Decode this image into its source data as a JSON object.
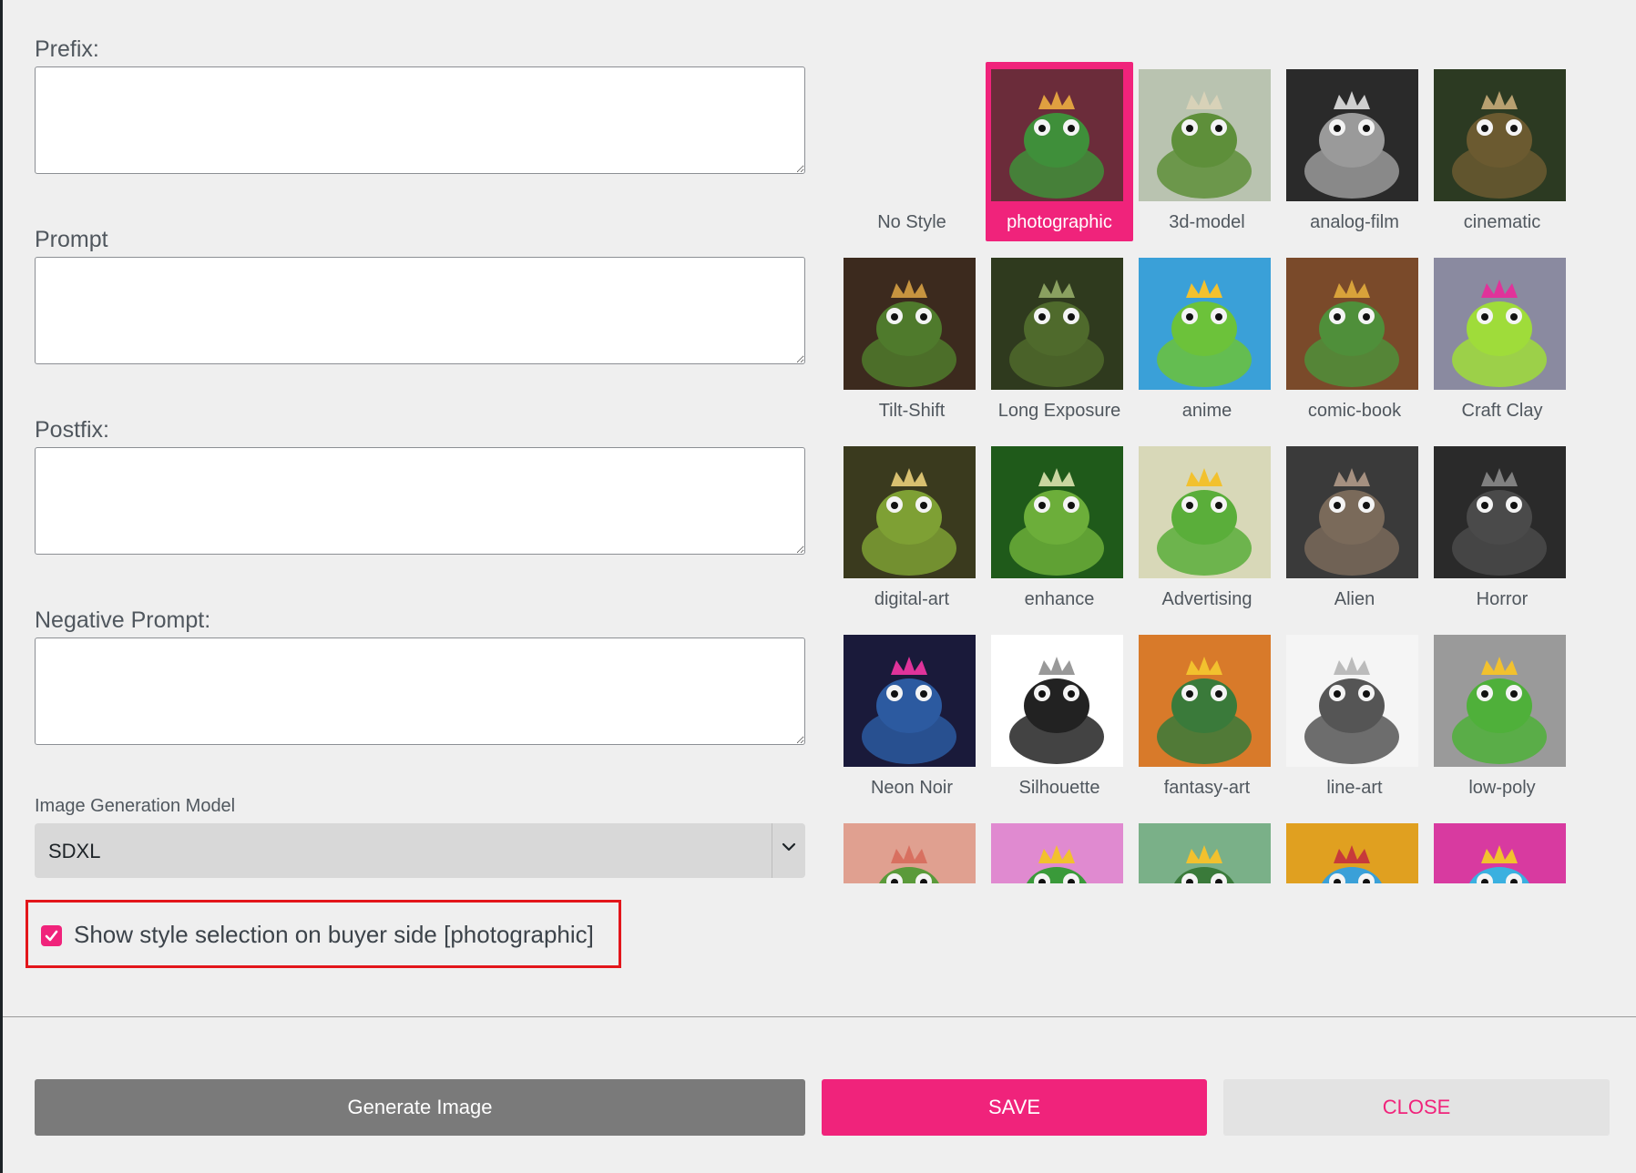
{
  "form": {
    "prefix_label": "Prefix:",
    "prompt_label": "Prompt",
    "postfix_label": "Postfix:",
    "negative_label": "Negative Prompt:",
    "prefix_value": "",
    "prompt_value": "",
    "postfix_value": "",
    "negative_value": "",
    "model_label": "Image Generation Model",
    "model_value": "SDXL",
    "show_style_label": "Show style selection on buyer side [photographic]",
    "show_style_checked": true
  },
  "styles": {
    "selected": "photographic",
    "items": [
      {
        "label": "No Style"
      },
      {
        "label": "photographic"
      },
      {
        "label": "3d-model"
      },
      {
        "label": "analog-film"
      },
      {
        "label": "cinematic"
      },
      {
        "label": "Tilt-Shift"
      },
      {
        "label": "Long Exposure"
      },
      {
        "label": "anime"
      },
      {
        "label": "comic-book"
      },
      {
        "label": "Craft Clay"
      },
      {
        "label": "digital-art"
      },
      {
        "label": "enhance"
      },
      {
        "label": "Advertising"
      },
      {
        "label": "Alien"
      },
      {
        "label": "Horror"
      },
      {
        "label": "Neon Noir"
      },
      {
        "label": "Silhouette"
      },
      {
        "label": "fantasy-art"
      },
      {
        "label": "line-art"
      },
      {
        "label": "low-poly"
      },
      {
        "label": ""
      },
      {
        "label": ""
      },
      {
        "label": ""
      },
      {
        "label": ""
      },
      {
        "label": ""
      }
    ]
  },
  "buttons": {
    "generate": "Generate Image",
    "save": "SAVE",
    "close": "CLOSE"
  },
  "colors": {
    "accent": "#f0237b",
    "highlight_border": "#e3161b"
  }
}
